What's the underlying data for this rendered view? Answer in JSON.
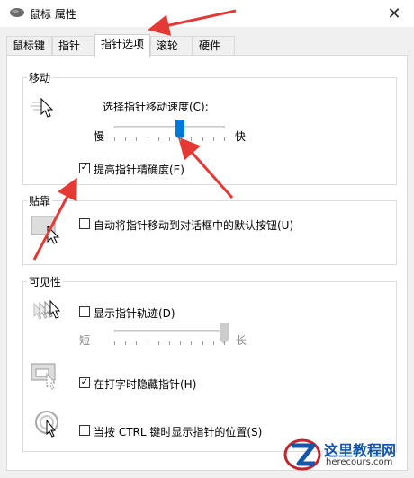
{
  "window": {
    "title": "鼠标 属性",
    "close_glyph": "✕"
  },
  "tabs": [
    {
      "label": "鼠标键"
    },
    {
      "label": "指针"
    },
    {
      "label": "指针选项",
      "active": true
    },
    {
      "label": "滚轮"
    },
    {
      "label": "硬件"
    }
  ],
  "motion": {
    "title": "移动",
    "speed_label": "选择指针移动速度(C):",
    "slow": "慢",
    "fast": "快",
    "speed_level": 0.6,
    "precision_label": "提高指针精确度(E)",
    "precision_checked": true
  },
  "snap": {
    "title": "贴靠",
    "label": "自动将指针移动到对话框中的默认按钮(U)",
    "checked": false
  },
  "visibility": {
    "title": "可见性",
    "trails_label": "显示指针轨迹(D)",
    "trails_checked": false,
    "short": "短",
    "long": "长",
    "trails_level": 1.0,
    "hide_label": "在打字时隐藏指针(H)",
    "hide_checked": true,
    "ctrl_label": "当按 CTRL 键时显示指针的位置(S)",
    "ctrl_checked": false
  },
  "watermark": {
    "title": "这里教程网",
    "url": "herecours.com"
  },
  "colors": {
    "accent": "#0078d7",
    "annotation": "#e53935"
  },
  "icons": [
    "mouse-icon",
    "close-icon",
    "pointer-speed-icon",
    "snap-to-button-icon",
    "pointer-trails-icon",
    "hide-pointer-icon",
    "pointer-location-icon"
  ]
}
